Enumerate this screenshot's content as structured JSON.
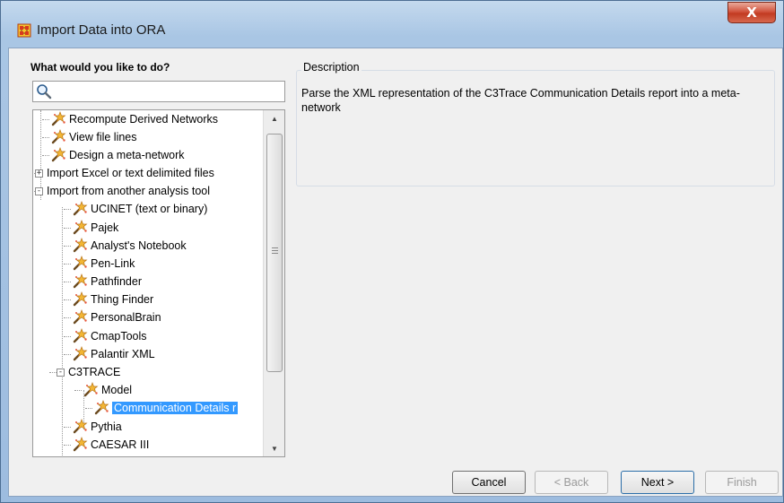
{
  "window": {
    "title": "Import Data into ORA",
    "close_label": "X"
  },
  "left": {
    "label": "What would you like to do?",
    "search": {
      "placeholder": "",
      "value": ""
    }
  },
  "tree": {
    "items": [
      {
        "label": "Recompute Derived Networks",
        "icon": "wand-icon"
      },
      {
        "label": "View file lines",
        "icon": "wand-icon"
      },
      {
        "label": "Design a meta-network",
        "icon": "wand-icon"
      },
      {
        "label": "Import Excel or text delimited files",
        "expander": "+"
      },
      {
        "label": "Import from another analysis tool",
        "expander": "-"
      },
      {
        "label": "UCINET (text or binary)",
        "icon": "wand-icon"
      },
      {
        "label": "Pajek",
        "icon": "wand-icon"
      },
      {
        "label": "Analyst's Notebook",
        "icon": "wand-icon"
      },
      {
        "label": "Pen-Link",
        "icon": "wand-icon"
      },
      {
        "label": "Pathfinder",
        "icon": "wand-icon"
      },
      {
        "label": "Thing Finder",
        "icon": "wand-icon"
      },
      {
        "label": "PersonalBrain",
        "icon": "wand-icon"
      },
      {
        "label": "CmapTools",
        "icon": "wand-icon"
      },
      {
        "label": "Palantir XML",
        "icon": "wand-icon"
      },
      {
        "label": "C3TRACE",
        "expander": "-"
      },
      {
        "label": "Model",
        "icon": "wand-icon"
      },
      {
        "label": "Communication Details r",
        "icon": "wand-icon",
        "selected": true
      },
      {
        "label": "Pythia",
        "icon": "wand-icon"
      },
      {
        "label": "CAESAR III",
        "icon": "wand-icon"
      }
    ]
  },
  "description": {
    "legend": "Description",
    "text": "Parse the XML representation of the C3Trace Communication Details report into a meta-network"
  },
  "buttons": {
    "cancel": "Cancel",
    "back": "< Back",
    "next": "Next >",
    "finish": "Finish"
  },
  "colors": {
    "selection": "#3399ff",
    "close": "#c23a21",
    "titlebar": "#a9c6e4"
  }
}
